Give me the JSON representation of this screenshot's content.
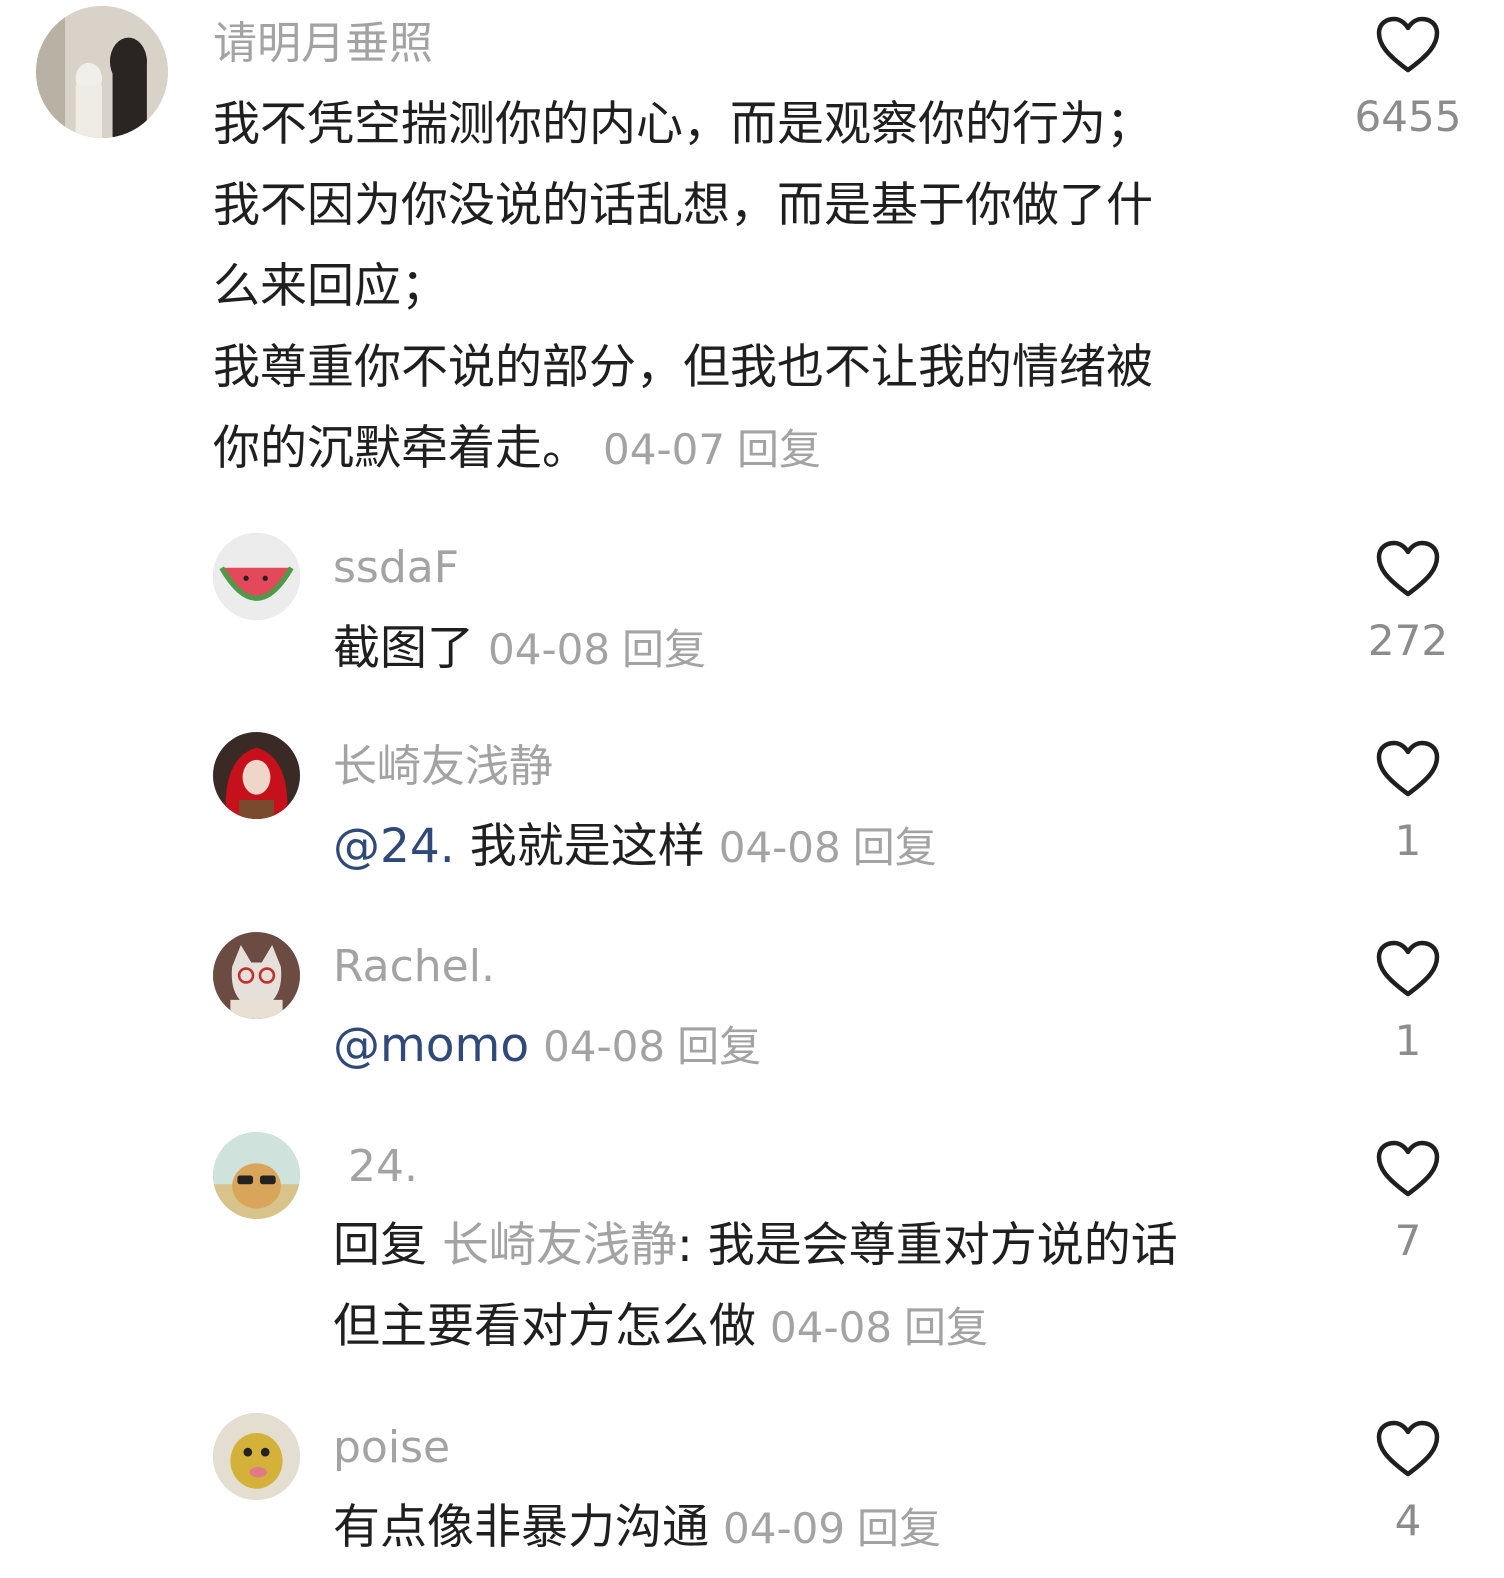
{
  "comments": [
    {
      "user": "请明月垂照",
      "text_lines": [
        "我不凭空揣测你的内心，而是观察你的行为；",
        "我不因为你没说的话乱想，而是基于你做了什",
        "么来回应；",
        "我尊重你不说的部分，但我也不让我的情绪被",
        "你的沉默牵着走。"
      ],
      "date": "04-07",
      "reply_label": "回复",
      "likes": "6455"
    },
    {
      "user": "ssdaF",
      "text": "截图了",
      "date": "04-08",
      "reply_label": "回复",
      "likes": "272"
    },
    {
      "user": "长崎友浅静",
      "mention": "@24.",
      "text": " 我就是这样",
      "date": "04-08",
      "reply_label": "回复",
      "likes": "1"
    },
    {
      "user": "Rachel.",
      "mention": "@momo",
      "text": "",
      "date": "04-08",
      "reply_label": "回复",
      "likes": "1"
    },
    {
      "user": "24.",
      "reply_prefix": "回复",
      "reply_to": "长崎友浅静",
      "text_line1": ": 我是会尊重对方说的话",
      "text_line2": "但主要看对方怎么做",
      "date": "04-08",
      "reply_label": "回复",
      "likes": "7"
    },
    {
      "user": "poise",
      "text": "有点像非暴力沟通",
      "date": "04-09",
      "reply_label": "回复",
      "likes": "4"
    }
  ],
  "icons": {
    "like": "heart-outline-icon"
  },
  "colors": {
    "username": "#a3a3a3",
    "mention": "#2f4a78",
    "meta": "#a3a3a3",
    "body_text": "#1f1f1f"
  }
}
